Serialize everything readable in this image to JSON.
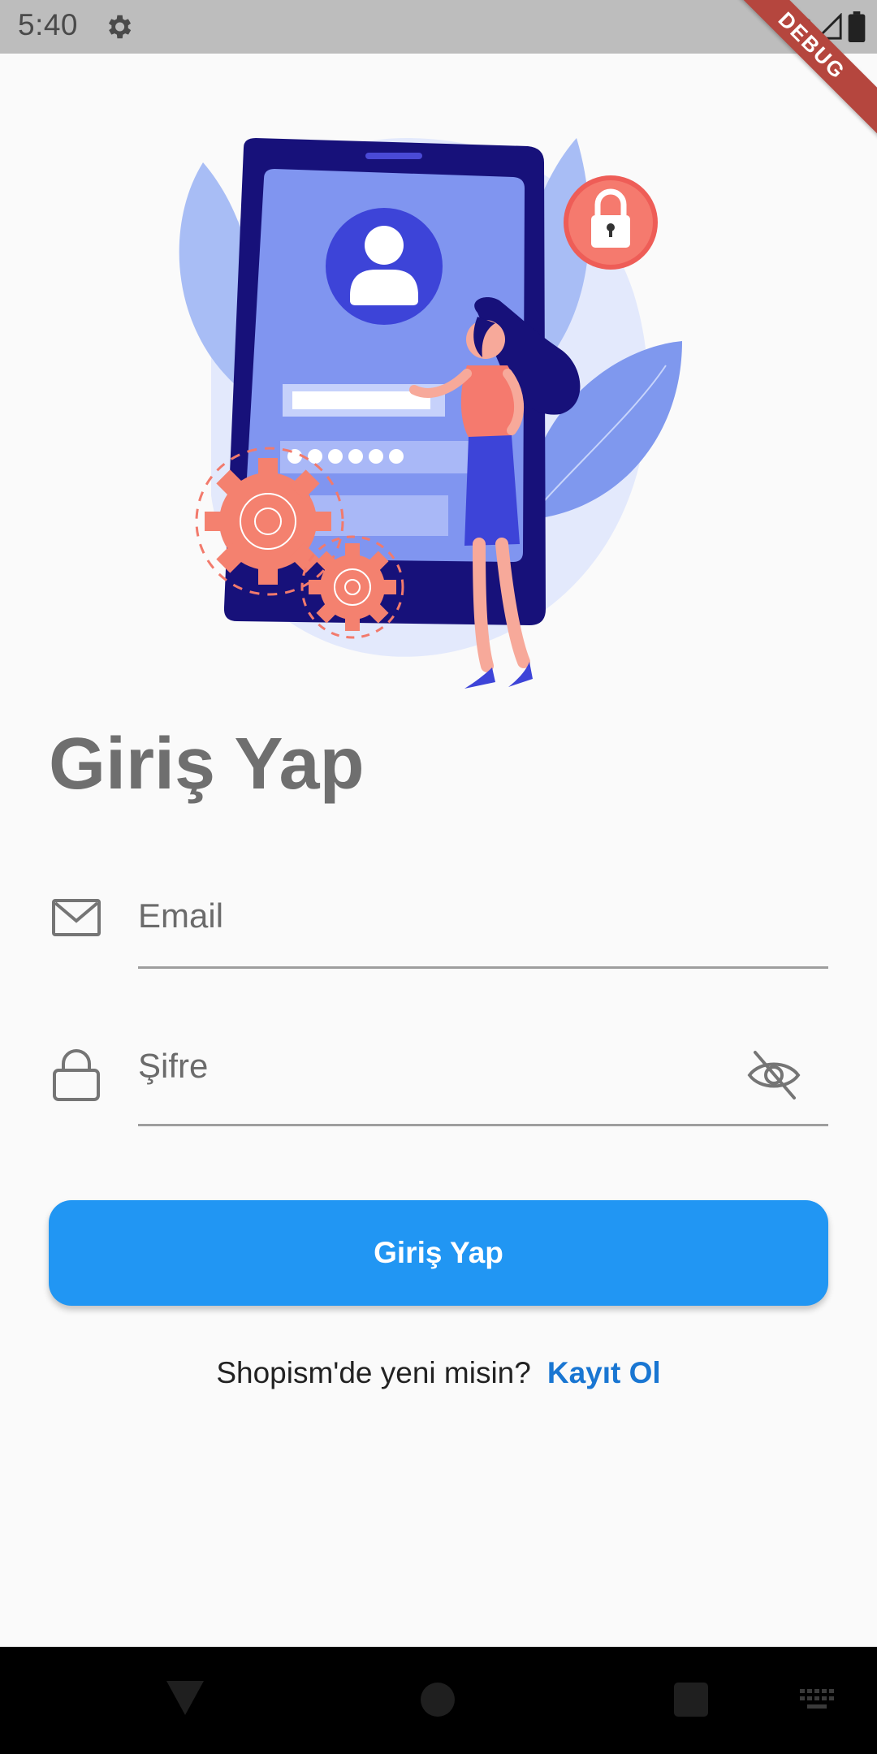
{
  "status_bar": {
    "time": "5:40",
    "debug_label": "DEBUG",
    "icons": [
      "settings-icon",
      "wifi-icon",
      "signal-icon",
      "battery-icon"
    ]
  },
  "login": {
    "title": "Giriş Yap",
    "email_placeholder": "Email",
    "password_placeholder": "Şifre",
    "button_label": "Giriş Yap",
    "register_prompt": "Shopism'de yeni misin?",
    "register_link": "Kayıt Ol"
  },
  "colors": {
    "accent": "#2196f3",
    "link": "#1976d2",
    "title": "#6f6f6f",
    "background": "#fafafa"
  },
  "nav_bar": {
    "icons": [
      "back-icon",
      "home-icon",
      "recents-icon",
      "keyboard-icon"
    ]
  }
}
